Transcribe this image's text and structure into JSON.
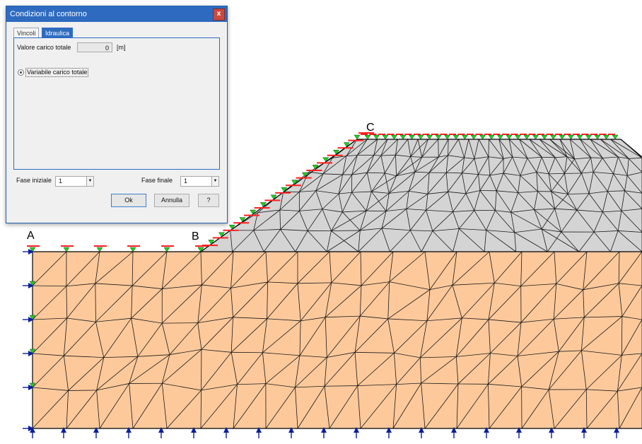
{
  "dialog": {
    "title": "Condizioni al contorno",
    "close_glyph": "x",
    "tabs": [
      "Vincoli",
      "Idraulica"
    ],
    "active_tab": "Idraulica",
    "valore_label": "Valore carico totale",
    "valore_value": "0",
    "valore_unit": "[m]",
    "radio_label": "Variabile carico totale",
    "fase_iniziale_label": "Fase iniziale",
    "fase_iniziale_value": "1",
    "fase_finale_label": "Fase finale",
    "fase_finale_value": "1",
    "ok_label": "Ok",
    "annulla_label": "Annulla",
    "help_label": "?"
  },
  "points": {
    "a": "A",
    "b": "B",
    "c": "C"
  },
  "colors": {
    "soil": "#fdc99b",
    "embankment": "#d4d4d4",
    "mesh_line": "#1a1a1a",
    "head_marker": "#22cc22",
    "constraint_arrow": "#0b1f9c",
    "annotation": "#ff2020"
  },
  "icons": {
    "close": "close-icon",
    "dropdown": "chevron-down-icon",
    "restraint": "arrow-icon",
    "head": "triangle-icon"
  }
}
